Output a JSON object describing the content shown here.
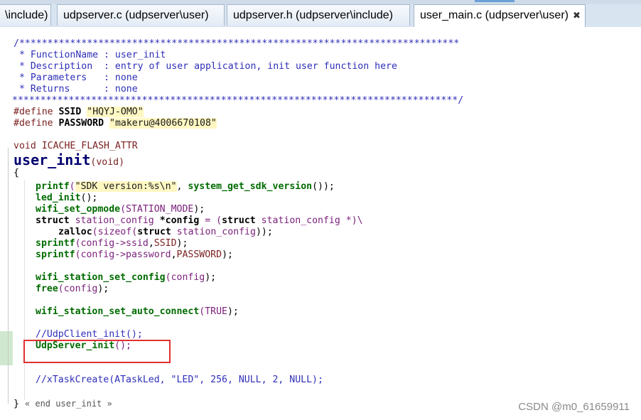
{
  "tabs": [
    {
      "label": "\\include)",
      "active": false
    },
    {
      "label": "udpserver.c (udpserver\\user)",
      "active": false
    },
    {
      "label": "udpserver.h (udpserver\\include)",
      "active": false
    },
    {
      "label": "user_main.c (udpserver\\user)",
      "active": true,
      "close": "✖"
    }
  ],
  "code": {
    "banner_top": "/******************************************************************************",
    "fn_name": " * FunctionName : user_init",
    "description": " * Description  : entry of user application, init user function here",
    "parameters": " * Parameters   : none",
    "returns": " * Returns      : none",
    "banner_bottom": "*******************************************************************************/",
    "define_kw": "#define",
    "ssid_name": "SSID",
    "ssid_value": "\"HQYJ-OMO\"",
    "password_name": "PASSWORD",
    "password_value": "\"makeru@4006670108\"",
    "void_kw": "void",
    "attr": "ICACHE_FLASH_ATTR",
    "fn_title": "user_init",
    "fn_params": "(void)",
    "open_brace": "{",
    "printf_fn": "printf",
    "printf_str": "\"SDK version:%s\\n\"",
    "sdk_fn": "system_get_sdk_version",
    "led_init": "led_init",
    "wifi_set_opmode": "wifi_set_opmode",
    "station_mode": "STATION_MODE",
    "struct_kw": "struct",
    "station_config": "station_config",
    "config_var": "*config",
    "zalloc": "zalloc",
    "sizeof_kw": "sizeof",
    "sprintf": "sprintf",
    "ssid_arg": "config->ssid",
    "password_arg": "config->password",
    "wifi_station_set_config": "wifi_station_set_config",
    "config": "config",
    "free_fn": "free",
    "auto_connect": "wifi_station_set_auto_connect",
    "true_val": "TRUE",
    "udp_client_comment": "//UdpClient_init();",
    "udp_server": "UdpServer_init",
    "task_comment": "//xTaskCreate(ATaskLed, \"LED\", 256, NULL, 2, NULL);",
    "close_brace": "}",
    "end_note": "« end user_init »"
  },
  "watermark": "CSDN @m0_61659911",
  "colors": {
    "comment": "#2e2eb8",
    "function": "#006b00",
    "highlight_box": "#e03030",
    "string_bg": "#fff7c2"
  }
}
